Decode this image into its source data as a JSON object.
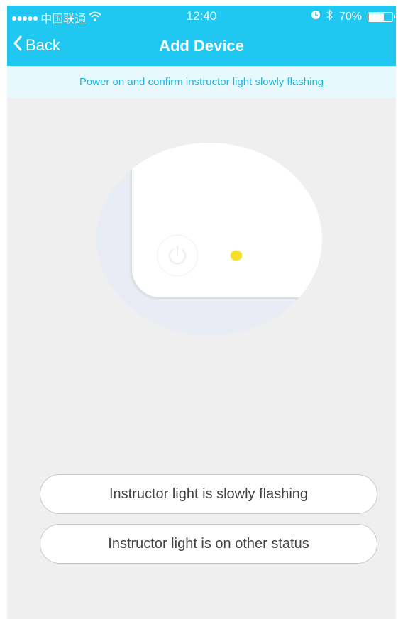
{
  "status_bar": {
    "signal_dots": "●●●●●",
    "carrier": "中国联通",
    "wifi_icon": "wifi-icon",
    "time": "12:40",
    "alarm_icon": "alarm-icon",
    "bluetooth_icon": "bluetooth-icon",
    "battery_percent": "70%",
    "battery_level": 0.7
  },
  "nav": {
    "back_label": "Back",
    "title": "Add Device"
  },
  "hint": {
    "text": "Power on and confirm instructor light slowly flashing"
  },
  "illustration": {
    "led_color": "#f4e02a",
    "power_icon": "power-icon"
  },
  "choices": [
    {
      "label": "Instructor light is slowly flashing"
    },
    {
      "label": "Instructor light is on other status"
    }
  ],
  "colors": {
    "accent": "#1fc7f1",
    "banner_text": "#1db6dc",
    "background": "#efefef"
  }
}
